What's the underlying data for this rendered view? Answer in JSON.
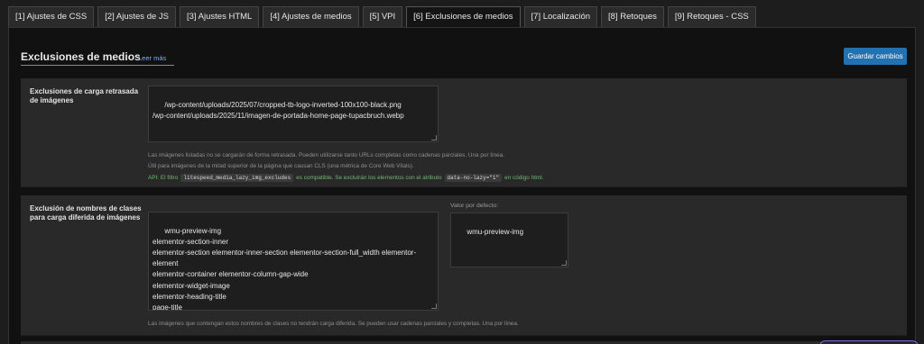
{
  "tabs": [
    {
      "label": "[1] Ajustes de CSS",
      "active": false
    },
    {
      "label": "[2] Ajustes de JS",
      "active": false
    },
    {
      "label": "[3] Ajustes HTML",
      "active": false
    },
    {
      "label": "[4] Ajustes de medios",
      "active": false
    },
    {
      "label": "[5] VPI",
      "active": false
    },
    {
      "label": "[6] Exclusiones de medios",
      "active": true
    },
    {
      "label": "[7] Localización",
      "active": false
    },
    {
      "label": "[8] Retoques",
      "active": false
    },
    {
      "label": "[9] Retoques - CSS",
      "active": false
    }
  ],
  "header": {
    "title": "Exclusiones de medios",
    "read_more": "Leer más",
    "save_label": "Guardar cambios"
  },
  "lazy_exclusions": {
    "label": "Exclusiones de carga retrasada de imágenes",
    "value": "/wp-content/uploads/2025/07/cropped-tb-logo-inverted-100x100-black.png\n/wp-content/uploads/2025/11/imagen-de-portada-home-page-tupacbruch.webp",
    "desc_line1": "Las imágenes listadas no se cargarán de forma retrasada. Pueden utilizarse tanto URLs completas como cadenas parciales. Una por línea.",
    "desc_line2": "Útil para imágenes de la mitad superior de la página que causan CLS (una métrica de Core Web Vitals).",
    "api_prefix": "API: El filtro",
    "api_filter": "litespeed_media_lazy_img_excludes",
    "api_middle": "es compatible. Se excluirán los elementos con el atributo",
    "api_attr": "data-no-lazy=\"1\"",
    "api_suffix": "en código html."
  },
  "class_exclusions": {
    "label": "Exclusión de nombres de clases para carga diferida de imágenes",
    "value": "wmu-preview-img\nelementor-section-inner\nelementor-section elementor-inner-section elementor-section-full_width elementor-element\nelementor-container elementor-column-gap-wide\nelementor-widget-image\nelementor-heading-title\npage-title\nhero",
    "default_label": "Valor por defecto:",
    "default_value": "wmu-preview-img",
    "desc": "Las imágenes que contengan estos nombres de clases no tendrán carga diferida. Se pueden usar cadenas parciales y completas. Una por línea."
  },
  "colors": {
    "accent": "#2271b1",
    "link": "#7fb0e6",
    "api_green": "#6fb86f"
  }
}
